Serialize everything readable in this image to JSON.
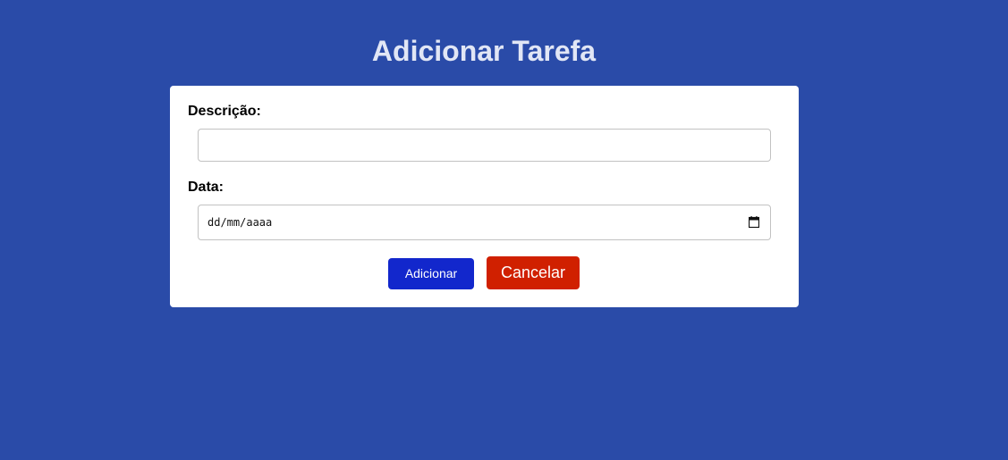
{
  "page": {
    "title": "Adicionar Tarefa"
  },
  "form": {
    "description": {
      "label": "Descrição:",
      "value": ""
    },
    "date": {
      "label": "Data:",
      "placeholder": "dd/mm/aaaa",
      "icon": "calendar-icon"
    },
    "buttons": {
      "add_label": "Adicionar",
      "cancel_label": "Cancelar"
    }
  },
  "colors": {
    "background": "#2a4ba8",
    "title_text": "#e1e6f5",
    "add_button": "#1227cc",
    "cancel_button": "#d02000"
  }
}
